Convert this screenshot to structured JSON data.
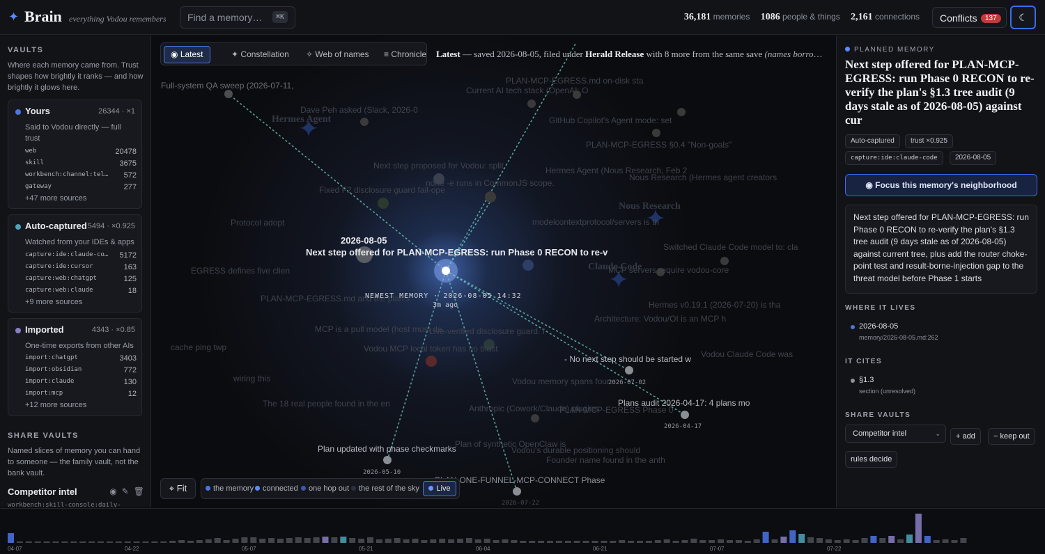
{
  "header": {
    "brand": "Brain",
    "tagline": "everything Vodou remembers",
    "search_placeholder": "Find a memory…",
    "search_shortcut": "⌘K",
    "stats": [
      {
        "value": "36,181",
        "label": "memories"
      },
      {
        "value": "1086",
        "label": "people & things"
      },
      {
        "value": "2,161",
        "label": "connections"
      }
    ],
    "conflicts_label": "Conflicts",
    "conflicts_count": "137",
    "theme_icon": "moon-icon"
  },
  "left": {
    "vaults_title": "VAULTS",
    "vaults_desc": "Where each memory came from. Trust shapes how brightly it ranks — and how brightly it glows here.",
    "vaults": [
      {
        "name": "Yours",
        "meta": "26344 · ×1",
        "color": "#4a76e6",
        "desc": "Said to Vodou directly — full trust",
        "sources": [
          {
            "label": "web",
            "count": "20478"
          },
          {
            "label": "skill",
            "count": "3675"
          },
          {
            "label": "workbench:channel:telegram",
            "count": "572"
          },
          {
            "label": "gateway",
            "count": "277"
          }
        ],
        "more": "+47 more sources"
      },
      {
        "name": "Auto-captured",
        "meta": "5494 · ×0.925",
        "color": "#4fa3b8",
        "desc": "Watched from your IDEs & apps",
        "sources": [
          {
            "label": "capture:ide:claude-code",
            "count": "5172"
          },
          {
            "label": "capture:ide:cursor",
            "count": "163"
          },
          {
            "label": "capture:web:chatgpt",
            "count": "125"
          },
          {
            "label": "capture:web:claude",
            "count": "18"
          }
        ],
        "more": "+9 more sources"
      },
      {
        "name": "Imported",
        "meta": "4343 · ×0.85",
        "color": "#8a7fc4",
        "desc": "One-time exports from other AIs",
        "sources": [
          {
            "label": "import:chatgpt",
            "count": "3403"
          },
          {
            "label": "import:obsidian",
            "count": "772"
          },
          {
            "label": "import:claude",
            "count": "130"
          },
          {
            "label": "import:mcp",
            "count": "12"
          }
        ],
        "more": "+12 more sources"
      }
    ],
    "share_title": "SHARE VAULTS",
    "share_desc": "Named slices of memory you can hand to someone — the family vault, not the bank vault.",
    "share_vault_name": "Competitor intel",
    "share_vault_sub": "workbench:skill-console:daily-"
  },
  "center": {
    "modes": [
      {
        "icon": "◉",
        "label": "Latest",
        "active": true
      },
      {
        "icon": "✦",
        "label": "Constellation",
        "active": false
      },
      {
        "icon": "✧",
        "label": "Web of names",
        "active": false
      },
      {
        "icon": "≡",
        "label": "Chronicle",
        "active": false
      }
    ],
    "latest": {
      "head": "Latest",
      "text1": " — saved 2026-08-05, filed under ",
      "topic": "Herald Release",
      "text2": " with 8 more from the same save ",
      "note": "(names borrowed from the notes nearby)"
    },
    "focus_date": "2026-08-05",
    "focus_label": "Next step offered for PLAN-MCP-EGRESS: run Phase 0 RECON to re-v",
    "newest_line": "NEWEST MEMORY · 2026-08-05 14:32",
    "newest_ago": "3m ago",
    "neighbors": [
      {
        "text": "- No next step should be started w",
        "date": "2026-07-02"
      },
      {
        "text": "Plans audit 2026-04-17: 4 plans mo",
        "date": "2026-04-17"
      },
      {
        "text": "Plan updated with phase checkmarks",
        "date": "2026-05-10"
      },
      {
        "text": "PLAN-ONE-FUNNEL-MCP-CONNECT Phase",
        "date": "2026-07-22"
      }
    ],
    "ghost_labels": [
      "Full-system QA sweep (2026-07-11,",
      "Current AI tech stack (OpenAI: O",
      "PLAN-MCP-EGRESS.md on-disk sta",
      "Dave Peh asked (Slack, 2026-0",
      "GitHub Copilot's Agent mode: set",
      "Hermes Agent",
      "PLAN-MCP-EGRESS §0.4 \"Non-goals\"",
      "Next step proposed for Vodou: split",
      "Hermes Agent (Nous Research, Feb 2",
      "none -e runs in CommonJS scope.",
      "Nous Research (Hermes agent creators",
      "Fixed F2 disclosure guard fail-ope",
      "Nous Research",
      "modelcontextprotocol/servers is th",
      "Protocol adopt",
      "Switched Claude Code model to: cla",
      "Claude Code",
      "MCP servers require vodou-core",
      "EGRESS defines five clien",
      "Hermes v0.19.1 (2026-07-20) is tha",
      "PLAN-MCP-EGRESS.md and the plan's",
      "Architecture: Vodou/OI is an MCP h",
      "MCP is a pull model (host must de",
      "Live-verified disclosure guard. f",
      "Vodou MCP local token has no blast",
      "Vodou Claude Code was",
      "Vodou memory spans four",
      "The 18 real people found in the en",
      "Anthropic (Cowork/Claude) plugins",
      "PLAN-MCP-EGRESS Phase 0",
      "Plan of synthetic OpenClaw is",
      "Vodou's durable positioning should",
      "Founder name found in the anth",
      "cache ping twp",
      "wiring this"
    ],
    "fit_label": "Fit",
    "legend": [
      {
        "label": "the memory",
        "color": "#4a76e6"
      },
      {
        "label": "connected",
        "color": "#5b8cff"
      },
      {
        "label": "one hop out",
        "color": "#3b5aa8"
      },
      {
        "label": "the rest of the sky",
        "color": "#2a3140"
      }
    ],
    "live_label": "Live"
  },
  "right": {
    "planned_label": "PLANNED MEMORY",
    "title": "Next step offered for PLAN-MCP-EGRESS: run Phase 0 RECON to re-verify the plan's §1.3 tree audit (9 days stale as of 2026-08-05) against cur",
    "chips": [
      "Auto-captured",
      "trust ×0.925",
      "capture:ide:claude-code",
      "2026-08-05"
    ],
    "focus_button": "Focus this memory's neighborhood",
    "body": "Next step offered for PLAN-MCP-EGRESS: run Phase 0 RECON to re-verify the plan's §1.3 tree audit (9 days stale as of 2026-08-05) against current tree, plus add the router choke-point test and result-borne-injection gap to the threat model before Phase 1 starts",
    "where_title": "WHERE IT LIVES",
    "where": {
      "title": "2026-08-05",
      "sub": "memory/2026-08-05.md:262"
    },
    "cites_title": "IT CITES",
    "cites": {
      "title": "§1.3",
      "sub": "section (unresolved)"
    },
    "share_title": "SHARE VAULTS",
    "share_select": "Competitor intel",
    "add_label": "+ add",
    "keep_label": "− keep out",
    "rules_label": "rules decide"
  },
  "timeline": {
    "dates": [
      "04-07",
      "04-22",
      "05-07",
      "05-21",
      "06-04",
      "06-21",
      "07-07",
      "07-22"
    ],
    "counts": [
      14,
      2,
      2,
      2,
      2,
      2,
      2,
      2,
      2,
      2,
      2,
      2,
      2,
      2,
      2,
      2,
      2,
      2,
      3,
      4,
      3,
      4,
      5,
      7,
      4,
      6,
      8,
      8,
      6,
      7,
      6,
      7,
      8,
      7,
      8,
      9,
      8,
      9,
      7,
      6,
      8,
      5,
      6,
      7,
      5,
      6,
      4,
      5,
      6,
      5,
      6,
      7,
      5,
      6,
      4,
      5,
      4,
      3,
      3,
      3,
      3,
      3,
      3,
      3,
      3,
      3,
      3,
      3,
      4,
      3,
      3,
      3,
      4,
      5,
      3,
      4,
      6,
      4,
      4,
      5,
      4,
      4,
      3,
      5,
      16,
      5,
      9,
      18,
      13,
      8,
      7,
      5,
      4,
      5,
      4,
      7,
      10,
      7,
      10,
      5,
      12,
      42,
      10,
      4,
      5,
      4,
      7
    ]
  }
}
